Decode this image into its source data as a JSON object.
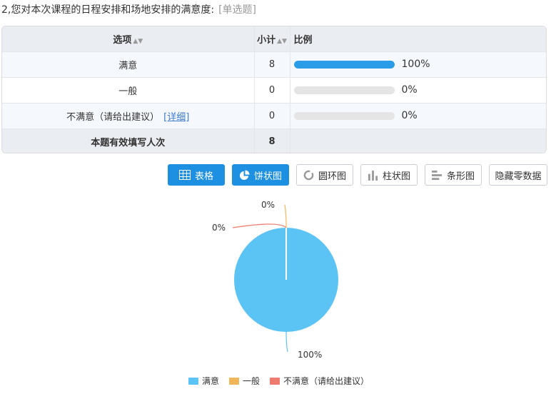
{
  "question": {
    "text": "2,您对本次课程的日程安排和场地安排的满意度:",
    "type": "[单选题]"
  },
  "table": {
    "headers": {
      "option": "选项",
      "count": "小计",
      "ratio": "比例"
    },
    "rows": [
      {
        "option": "满意",
        "count": "8",
        "percent": "100%",
        "fraction": 1.0,
        "detail": ""
      },
      {
        "option": "一般",
        "count": "0",
        "percent": "0%",
        "fraction": 0.0,
        "detail": ""
      },
      {
        "option": "不满意（请给出建议）",
        "count": "0",
        "percent": "0%",
        "fraction": 0.0,
        "detail": "[详细]"
      }
    ],
    "total": {
      "label": "本题有效填写人次",
      "count": "8"
    }
  },
  "toolbar": {
    "table": "表格",
    "pie": "饼状图",
    "donut": "圆环图",
    "column": "柱状图",
    "bar": "条形图",
    "hide_zero": "隐藏零数据"
  },
  "colors": {
    "accent": "#1e90e2",
    "bar": "#2a9ce8",
    "s1": "#5bc4f5",
    "s2": "#f2b65a",
    "s3": "#ef7b70"
  },
  "chart_data": {
    "type": "pie",
    "categories": [
      "满意",
      "一般",
      "不满意（请给出建议）"
    ],
    "values": [
      8,
      0,
      0
    ],
    "labels": [
      "100%",
      "0%",
      "0%"
    ],
    "legend": "bottom"
  }
}
